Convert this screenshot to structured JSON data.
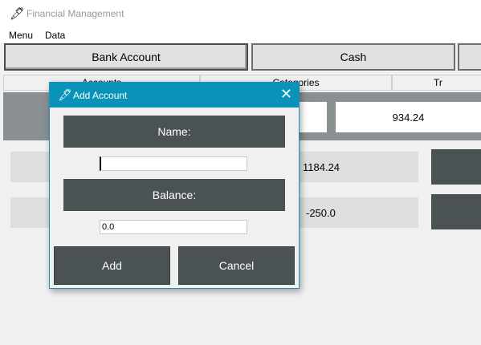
{
  "window": {
    "title": "Financial Management",
    "icon": "feather-icon"
  },
  "menubar": {
    "items": [
      "Menu",
      "Data"
    ]
  },
  "top_buttons": {
    "bank_account": "Bank Account",
    "cash": "Cash"
  },
  "tabs": [
    "Accounts",
    "Categories",
    "Tr"
  ],
  "summary": {
    "value": "934.24"
  },
  "rows": [
    {
      "value": "1184.24"
    },
    {
      "value": "-250.0"
    }
  ],
  "dialog": {
    "title": "Add Account",
    "icon": "feather-icon",
    "name_label": "Name:",
    "name_value": "",
    "balance_label": "Balance:",
    "balance_value": "0.0",
    "add_label": "Add",
    "cancel_label": "Cancel"
  },
  "colors": {
    "accent": "#0a93b8",
    "dark_button": "#4b5254",
    "row_bg": "#dedede"
  }
}
